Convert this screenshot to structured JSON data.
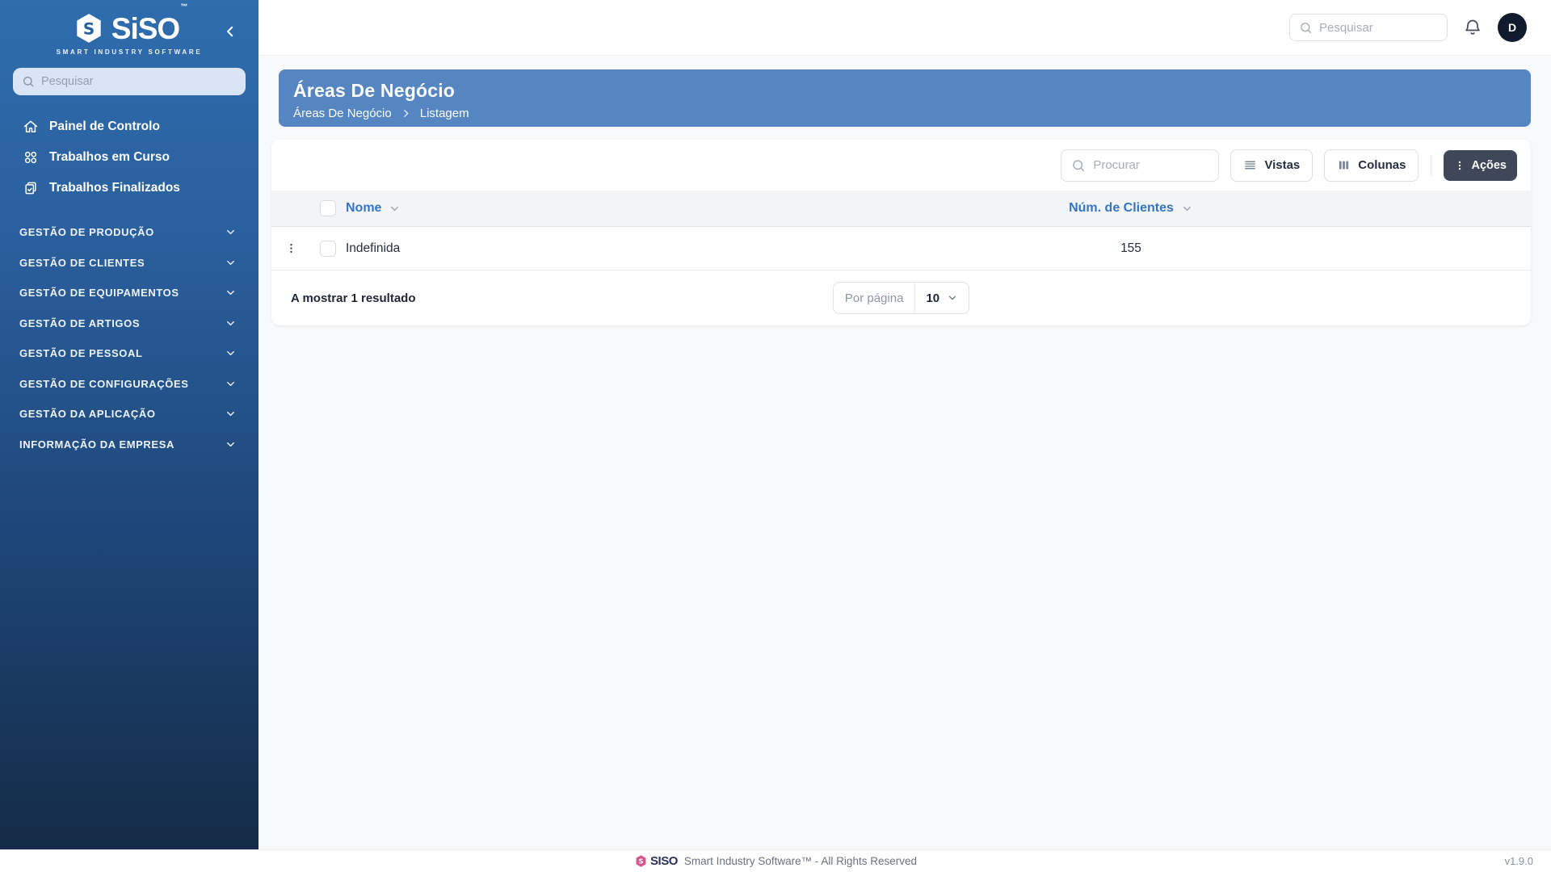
{
  "sidebar": {
    "logo_text": "SiSO",
    "logo_tm": "™",
    "logo_tagline": "SMART INDUSTRY SOFTWARE",
    "search_placeholder": "Pesquisar",
    "items": [
      {
        "label": "Painel de Controlo",
        "icon": "home-icon"
      },
      {
        "label": "Trabalhos em Curso",
        "icon": "grid-circles-icon"
      },
      {
        "label": "Trabalhos Finalizados",
        "icon": "clipboard-check-icon"
      }
    ],
    "sections": [
      {
        "label": "GESTÃO DE PRODUÇÃO"
      },
      {
        "label": "GESTÃO DE CLIENTES"
      },
      {
        "label": "GESTÃO DE EQUIPAMENTOS"
      },
      {
        "label": "GESTÃO DE ARTIGOS"
      },
      {
        "label": "GESTÃO DE PESSOAL"
      },
      {
        "label": "GESTÃO DE CONFIGURAÇÕES"
      },
      {
        "label": "GESTÃO DA APLICAÇÃO"
      },
      {
        "label": "INFORMAÇÃO DA EMPRESA"
      }
    ]
  },
  "topbar": {
    "search_placeholder": "Pesquisar",
    "avatar_initial": "D"
  },
  "page_header": {
    "title": "Áreas De Negócio",
    "breadcrumb_root": "Áreas De Negócio",
    "breadcrumb_current": "Listagem"
  },
  "toolbar": {
    "search_placeholder": "Procurar",
    "vistas_label": "Vistas",
    "colunas_label": "Colunas",
    "acoes_label": "Ações"
  },
  "table": {
    "col_nome": "Nome",
    "col_num_clientes": "Núm. de Clientes",
    "rows": [
      {
        "nome": "Indefinida",
        "num_clientes": "155"
      }
    ]
  },
  "pagination": {
    "summary": "A mostrar 1 resultado",
    "per_page_label": "Por página",
    "per_page_value": "10"
  },
  "footer": {
    "brand": "SISO",
    "copyright": "Smart Industry Software™ - All Rights Reserved",
    "version": "v1.9.0"
  },
  "colors": {
    "sidebar_top": "#2f6dae",
    "sidebar_bottom": "#152b47",
    "banner_blue": "#5586c1",
    "accent_blue": "#3575c4",
    "acoes_button": "#3e4859",
    "avatar_bg": "#101b2d",
    "footer_brand_pink": "#d6568e"
  }
}
